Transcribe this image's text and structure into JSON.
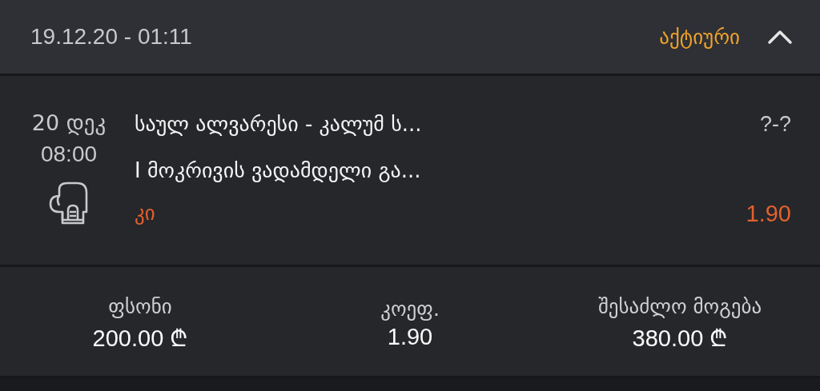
{
  "header": {
    "datetime": "19.12.20 - 01:11",
    "status": "აქტიური",
    "expanded": true
  },
  "bet": {
    "date": "20 დეკ",
    "time": "08:00",
    "event": "საულ ალვარესი - კალუმ ს...",
    "market": "I მოკრივის ვადამდელი გა...",
    "pick": "კი",
    "score": "?-?",
    "odds": "1.90"
  },
  "summary": [
    {
      "label": "ფსონი",
      "value": "200.00 ₾"
    },
    {
      "label": "კოეფ.",
      "value": "1.90"
    },
    {
      "label": "შესაძლო მოგება",
      "value": "380.00 ₾"
    }
  ]
}
